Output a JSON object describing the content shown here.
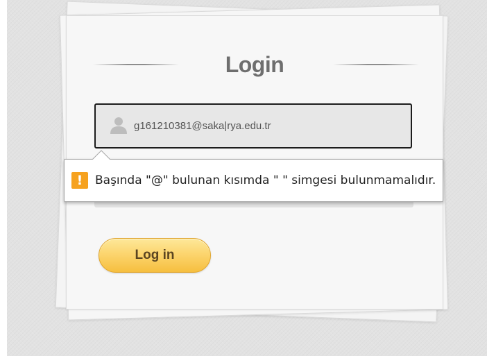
{
  "login": {
    "title": "Login",
    "username_value": "g161210381@saka|rya.edu.tr",
    "login_button_label": "Log in"
  },
  "validation": {
    "icon_glyph": "!",
    "message": "Başında \"@\" bulunan kısımda \" \" simgesi bulunmamalıdır."
  },
  "icons": {
    "user": "user-icon",
    "warning": "warning-icon"
  },
  "colors": {
    "button_accent": "#fcd56f",
    "warning": "#f6a21f",
    "title_text": "#6e6e6e"
  }
}
